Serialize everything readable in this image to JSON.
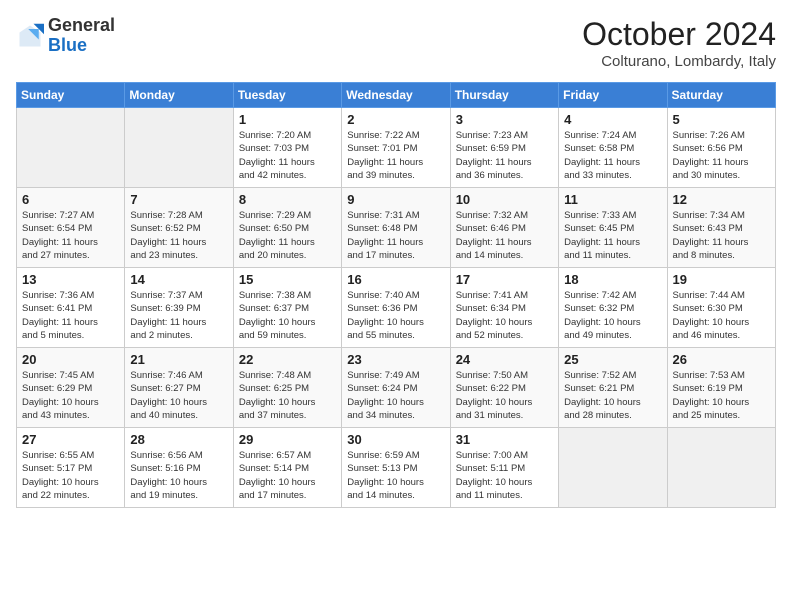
{
  "header": {
    "logo_general": "General",
    "logo_blue": "Blue",
    "month_title": "October 2024",
    "subtitle": "Colturano, Lombardy, Italy"
  },
  "days_of_week": [
    "Sunday",
    "Monday",
    "Tuesday",
    "Wednesday",
    "Thursday",
    "Friday",
    "Saturday"
  ],
  "weeks": [
    [
      {
        "day": "",
        "info": ""
      },
      {
        "day": "",
        "info": ""
      },
      {
        "day": "1",
        "info": "Sunrise: 7:20 AM\nSunset: 7:03 PM\nDaylight: 11 hours\nand 42 minutes."
      },
      {
        "day": "2",
        "info": "Sunrise: 7:22 AM\nSunset: 7:01 PM\nDaylight: 11 hours\nand 39 minutes."
      },
      {
        "day": "3",
        "info": "Sunrise: 7:23 AM\nSunset: 6:59 PM\nDaylight: 11 hours\nand 36 minutes."
      },
      {
        "day": "4",
        "info": "Sunrise: 7:24 AM\nSunset: 6:58 PM\nDaylight: 11 hours\nand 33 minutes."
      },
      {
        "day": "5",
        "info": "Sunrise: 7:26 AM\nSunset: 6:56 PM\nDaylight: 11 hours\nand 30 minutes."
      }
    ],
    [
      {
        "day": "6",
        "info": "Sunrise: 7:27 AM\nSunset: 6:54 PM\nDaylight: 11 hours\nand 27 minutes."
      },
      {
        "day": "7",
        "info": "Sunrise: 7:28 AM\nSunset: 6:52 PM\nDaylight: 11 hours\nand 23 minutes."
      },
      {
        "day": "8",
        "info": "Sunrise: 7:29 AM\nSunset: 6:50 PM\nDaylight: 11 hours\nand 20 minutes."
      },
      {
        "day": "9",
        "info": "Sunrise: 7:31 AM\nSunset: 6:48 PM\nDaylight: 11 hours\nand 17 minutes."
      },
      {
        "day": "10",
        "info": "Sunrise: 7:32 AM\nSunset: 6:46 PM\nDaylight: 11 hours\nand 14 minutes."
      },
      {
        "day": "11",
        "info": "Sunrise: 7:33 AM\nSunset: 6:45 PM\nDaylight: 11 hours\nand 11 minutes."
      },
      {
        "day": "12",
        "info": "Sunrise: 7:34 AM\nSunset: 6:43 PM\nDaylight: 11 hours\nand 8 minutes."
      }
    ],
    [
      {
        "day": "13",
        "info": "Sunrise: 7:36 AM\nSunset: 6:41 PM\nDaylight: 11 hours\nand 5 minutes."
      },
      {
        "day": "14",
        "info": "Sunrise: 7:37 AM\nSunset: 6:39 PM\nDaylight: 11 hours\nand 2 minutes."
      },
      {
        "day": "15",
        "info": "Sunrise: 7:38 AM\nSunset: 6:37 PM\nDaylight: 10 hours\nand 59 minutes."
      },
      {
        "day": "16",
        "info": "Sunrise: 7:40 AM\nSunset: 6:36 PM\nDaylight: 10 hours\nand 55 minutes."
      },
      {
        "day": "17",
        "info": "Sunrise: 7:41 AM\nSunset: 6:34 PM\nDaylight: 10 hours\nand 52 minutes."
      },
      {
        "day": "18",
        "info": "Sunrise: 7:42 AM\nSunset: 6:32 PM\nDaylight: 10 hours\nand 49 minutes."
      },
      {
        "day": "19",
        "info": "Sunrise: 7:44 AM\nSunset: 6:30 PM\nDaylight: 10 hours\nand 46 minutes."
      }
    ],
    [
      {
        "day": "20",
        "info": "Sunrise: 7:45 AM\nSunset: 6:29 PM\nDaylight: 10 hours\nand 43 minutes."
      },
      {
        "day": "21",
        "info": "Sunrise: 7:46 AM\nSunset: 6:27 PM\nDaylight: 10 hours\nand 40 minutes."
      },
      {
        "day": "22",
        "info": "Sunrise: 7:48 AM\nSunset: 6:25 PM\nDaylight: 10 hours\nand 37 minutes."
      },
      {
        "day": "23",
        "info": "Sunrise: 7:49 AM\nSunset: 6:24 PM\nDaylight: 10 hours\nand 34 minutes."
      },
      {
        "day": "24",
        "info": "Sunrise: 7:50 AM\nSunset: 6:22 PM\nDaylight: 10 hours\nand 31 minutes."
      },
      {
        "day": "25",
        "info": "Sunrise: 7:52 AM\nSunset: 6:21 PM\nDaylight: 10 hours\nand 28 minutes."
      },
      {
        "day": "26",
        "info": "Sunrise: 7:53 AM\nSunset: 6:19 PM\nDaylight: 10 hours\nand 25 minutes."
      }
    ],
    [
      {
        "day": "27",
        "info": "Sunrise: 6:55 AM\nSunset: 5:17 PM\nDaylight: 10 hours\nand 22 minutes."
      },
      {
        "day": "28",
        "info": "Sunrise: 6:56 AM\nSunset: 5:16 PM\nDaylight: 10 hours\nand 19 minutes."
      },
      {
        "day": "29",
        "info": "Sunrise: 6:57 AM\nSunset: 5:14 PM\nDaylight: 10 hours\nand 17 minutes."
      },
      {
        "day": "30",
        "info": "Sunrise: 6:59 AM\nSunset: 5:13 PM\nDaylight: 10 hours\nand 14 minutes."
      },
      {
        "day": "31",
        "info": "Sunrise: 7:00 AM\nSunset: 5:11 PM\nDaylight: 10 hours\nand 11 minutes."
      },
      {
        "day": "",
        "info": ""
      },
      {
        "day": "",
        "info": ""
      }
    ]
  ]
}
